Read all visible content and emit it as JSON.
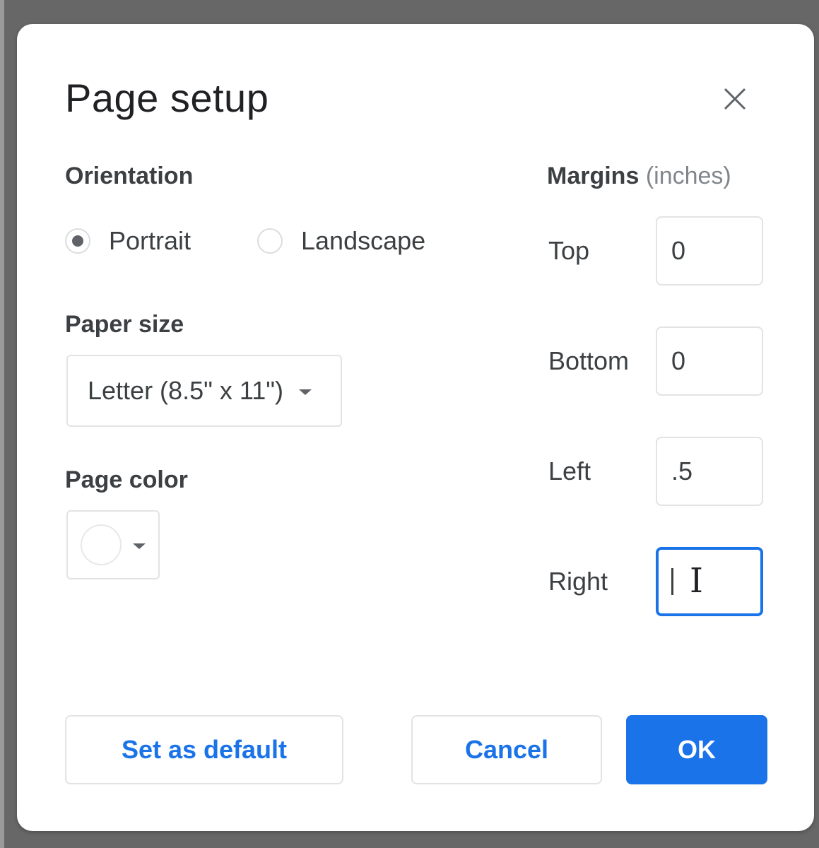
{
  "dialog": {
    "title": "Page setup",
    "close_icon": "close-icon"
  },
  "orientation": {
    "label": "Orientation",
    "options": [
      {
        "label": "Portrait",
        "selected": true
      },
      {
        "label": "Landscape",
        "selected": false
      }
    ]
  },
  "paper_size": {
    "label": "Paper size",
    "selected": "Letter (8.5\" x 11\")",
    "dropdown_icon": "caret-down-icon"
  },
  "page_color": {
    "label": "Page color",
    "selected_color": "#ffffff",
    "dropdown_icon": "caret-down-icon"
  },
  "margins": {
    "label": "Margins",
    "unit": "(inches)",
    "fields": [
      {
        "label": "Top",
        "value": "0"
      },
      {
        "label": "Bottom",
        "value": "0"
      },
      {
        "label": "Left",
        "value": ".5"
      },
      {
        "label": "Right",
        "value": "",
        "focused": true
      }
    ]
  },
  "buttons": {
    "set_default": "Set as default",
    "cancel": "Cancel",
    "ok": "OK"
  },
  "colors": {
    "accent": "#1a73e8",
    "backdrop": "#676767",
    "text": "#3c4043"
  }
}
